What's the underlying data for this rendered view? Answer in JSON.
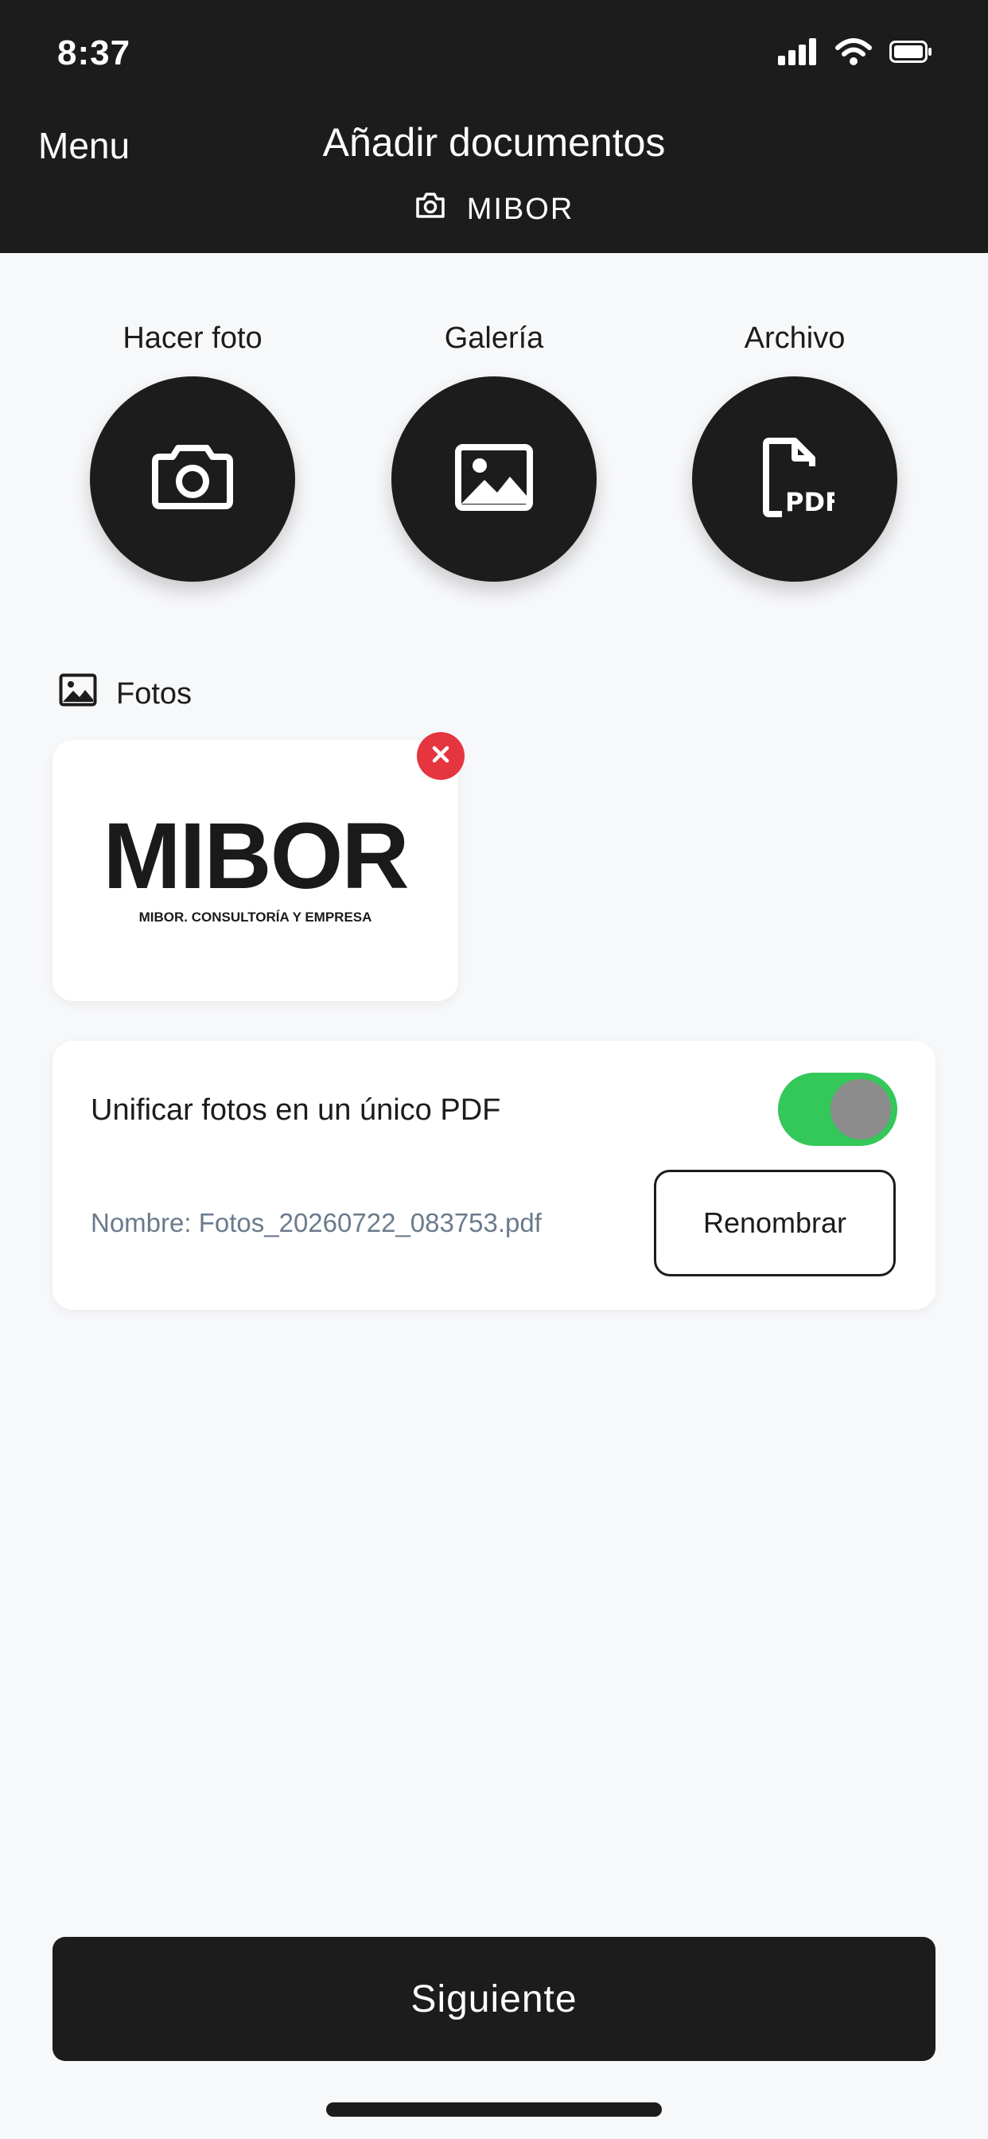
{
  "status_bar": {
    "time": "8:37",
    "icons": [
      "signal-icon",
      "wifi-icon",
      "battery-icon"
    ]
  },
  "header": {
    "menu_label": "Menu",
    "title": "Añadir documentos",
    "subtitle_icon": "camera-icon",
    "subtitle": "MIBOR"
  },
  "actions": [
    {
      "label": "Hacer foto",
      "icon": "camera-icon"
    },
    {
      "label": "Galería",
      "icon": "image-icon"
    },
    {
      "label": "Archivo",
      "icon": "pdf-file-icon",
      "icon_text": "PDF"
    }
  ],
  "photos_section": {
    "title": "Fotos",
    "icon": "image-icon",
    "items": [
      {
        "logo_text": "MIBOR",
        "logo_subtext": "MIBOR. CONSULTORÍA Y EMPRESA"
      }
    ]
  },
  "merge_option": {
    "label": "Unificar fotos en un único PDF",
    "enabled": true,
    "file_name": "Nombre: Fotos_20260722_083753.pdf",
    "rename_label": "Renombrar"
  },
  "footer": {
    "next_label": "Siguiente"
  },
  "colors": {
    "header_bg": "#1c1c1c",
    "page_bg": "#f7f8fa",
    "toggle_on": "#34c759",
    "remove_red": "#e5353f",
    "muted_text": "#6b7a8c"
  }
}
